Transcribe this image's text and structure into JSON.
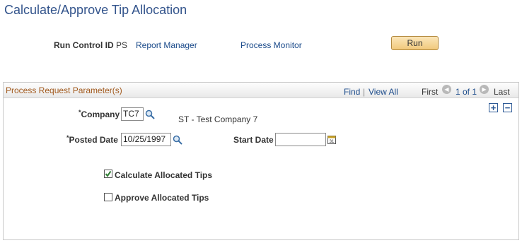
{
  "page": {
    "title": "Calculate/Approve Tip Allocation"
  },
  "run_control": {
    "label": "Run Control ID",
    "value": "PS",
    "report_manager": "Report Manager",
    "process_monitor": "Process Monitor",
    "run_label": "Run"
  },
  "group": {
    "title": "Process Request Parameter(s)",
    "find": "Find",
    "separator": "|",
    "view_all": "View All",
    "first": "First",
    "page_range": "1 of 1",
    "last": "Last",
    "add_row": "+",
    "delete_row": "−"
  },
  "form": {
    "required_marker": "*",
    "company_label": "Company",
    "company_value": "TC7",
    "company_desc": "ST - Test Company 7",
    "posted_date_label": "Posted Date",
    "posted_date_value": "10/25/1997",
    "start_date_label": "Start Date",
    "start_date_value": "",
    "calculate_label": "Calculate Allocated Tips",
    "calculate_checked": true,
    "approve_label": "Approve Allocated Tips",
    "approve_checked": false
  },
  "icons": {
    "lookup": "magnifier-icon",
    "calendar": "calendar-icon",
    "prev": "arrow-left-icon",
    "next": "arrow-right-icon"
  },
  "colors": {
    "title": "#33548c",
    "link": "#1a4a8a",
    "group_title": "#a25a1e",
    "run_button": "#f1c97c"
  }
}
